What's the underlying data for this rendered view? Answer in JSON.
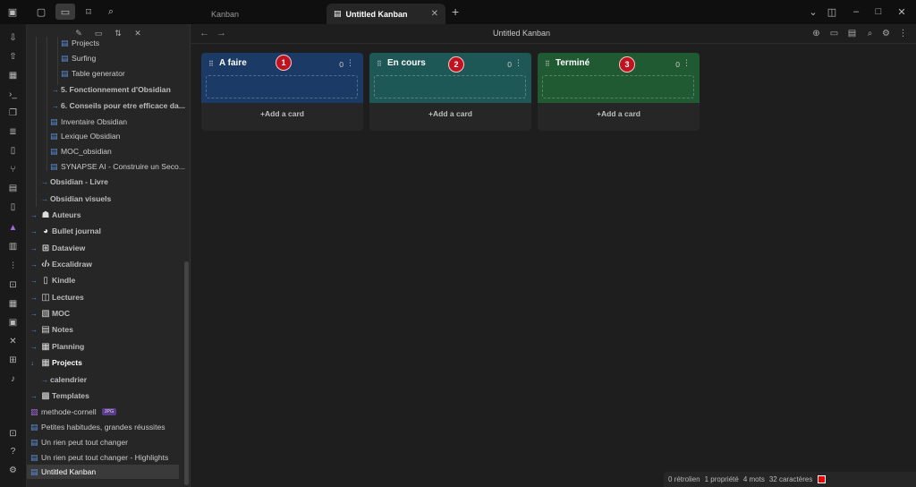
{
  "titlebar": {
    "tabs": [
      {
        "label": "Kanban"
      },
      {
        "label": "Untitled Kanban"
      }
    ],
    "new_tab": "+",
    "window_controls": [
      "chevron-down-icon",
      "layout-icon",
      "minimize-icon",
      "maximize-icon",
      "close-icon"
    ]
  },
  "ribbon": {
    "icons": [
      "inbox-down-icon",
      "inbox-up-icon",
      "presentation-icon",
      "terminal-icon",
      "copy-icon",
      "layers-icon",
      "file-code-icon",
      "git-fork-icon",
      "table-icon",
      "tablet-icon",
      "mountain-icon",
      "layout-template-icon",
      "sliders-icon",
      "bracket-icon",
      "calendar-icon",
      "panel-icon",
      "tools-icon",
      "grid-icon",
      "microphone-icon",
      "help-box-icon",
      "help-circle-icon",
      "settings-icon"
    ]
  },
  "sidebar": {
    "toolbar": [
      "new-note-icon",
      "new-folder-icon",
      "sort-icon",
      "collapse-icon"
    ],
    "items": [
      {
        "label": "Projects",
        "type": "file",
        "indent": 3
      },
      {
        "label": "Surfing",
        "type": "file",
        "indent": 3
      },
      {
        "label": "Table generator",
        "type": "file",
        "indent": 3
      },
      {
        "label": "5. Fonctionnement d'Obsidian",
        "type": "folder",
        "indent": 2
      },
      {
        "label": "6. Conseils pour etre efficace da...",
        "type": "folder",
        "indent": 2
      },
      {
        "label": "Inventaire Obsidian",
        "type": "file",
        "indent": 2
      },
      {
        "label": "Lexique Obsidian",
        "type": "file",
        "indent": 2
      },
      {
        "label": "MOC_obsidian",
        "type": "file",
        "indent": 2
      },
      {
        "label": "SYNAPSE AI - Construire un Seco...",
        "type": "file",
        "indent": 2
      },
      {
        "label": "Obsidian - Livre",
        "type": "folder",
        "indent": 1
      },
      {
        "label": "Obsidian visuels",
        "type": "folder",
        "indent": 1
      },
      {
        "label": "Auteurs",
        "type": "folder",
        "indent": 0,
        "icon": "people-icon"
      },
      {
        "label": "Bullet journal",
        "type": "folder",
        "indent": 0,
        "icon": "globe-icon"
      },
      {
        "label": "Dataview",
        "type": "folder",
        "indent": 0,
        "icon": "table-icon"
      },
      {
        "label": "Excalidraw",
        "type": "folder",
        "indent": 0,
        "icon": "code-icon"
      },
      {
        "label": "Kindle",
        "type": "folder",
        "indent": 0,
        "icon": "tablet-icon"
      },
      {
        "label": "Lectures",
        "type": "folder",
        "indent": 0,
        "icon": "book-icon"
      },
      {
        "label": "MOC",
        "type": "folder",
        "indent": 0,
        "icon": "search-doc-icon"
      },
      {
        "label": "Notes",
        "type": "folder",
        "indent": 0,
        "icon": "note-icon"
      },
      {
        "label": "Planning",
        "type": "folder",
        "indent": 0,
        "icon": "calendar-icon"
      },
      {
        "label": "Projects",
        "type": "folder-open",
        "indent": 0,
        "icon": "calendar-icon"
      },
      {
        "label": "calendrier",
        "type": "folder",
        "indent": 1
      },
      {
        "label": "Templates",
        "type": "folder",
        "indent": 0,
        "icon": "template-icon"
      },
      {
        "label": "methode-cornell",
        "type": "file",
        "indent": 0,
        "badge": "JPG"
      },
      {
        "label": "Petites habitudes, grandes réussites",
        "type": "file",
        "indent": 0
      },
      {
        "label": "Un rien peut tout changer",
        "type": "file",
        "indent": 0
      },
      {
        "label": "Un rien peut tout changer - Highlights",
        "type": "file",
        "indent": 0
      },
      {
        "label": "Untitled Kanban",
        "type": "file",
        "indent": 0,
        "selected": true
      }
    ]
  },
  "view": {
    "title": "Untitled Kanban",
    "actions": [
      "add-circle-icon",
      "archive-icon",
      "file-icon",
      "search-icon",
      "gear-icon",
      "more-vertical-icon"
    ]
  },
  "lanes": [
    {
      "title": "A faire",
      "count": "0",
      "add_label": "+Add a card",
      "color": "#1b3a66",
      "marker": "1"
    },
    {
      "title": "En cours",
      "count": "0",
      "add_label": "+Add a card",
      "color": "#1e5856",
      "marker": "2"
    },
    {
      "title": "Terminé",
      "count": "0",
      "add_label": "+Add a card",
      "color": "#1f5a32",
      "marker": "3"
    }
  ],
  "status": {
    "backlinks": "0 rétrolien",
    "properties": "1 propriété",
    "words": "4 mots",
    "chars": "32 caractères"
  },
  "colors": {
    "accent": "#4a8fd6",
    "marker": "#c1121f"
  }
}
